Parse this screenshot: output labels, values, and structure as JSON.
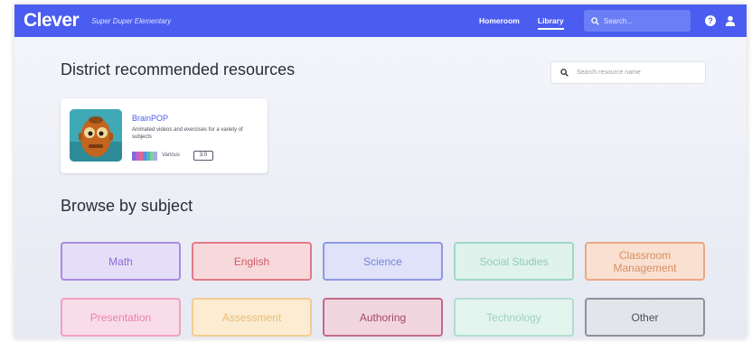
{
  "header": {
    "logo": "Clever",
    "school_name": "Super Duper Elementary",
    "nav": [
      "Homeroom",
      "Library"
    ],
    "active_nav": "Library",
    "search_placeholder": "Search..."
  },
  "district": {
    "heading": "District recommended resources",
    "search_placeholder": "Search resource name"
  },
  "resource_card": {
    "name": "BrainPOP",
    "description": "Animated videos and exercises for a variety of subjects",
    "verified_label": "Various",
    "version": "3.0"
  },
  "browse": {
    "heading": "Browse by subject",
    "subjects": [
      {
        "label": "Math",
        "bg": "#e5def8",
        "border": "#a98be0",
        "color": "#8a6bd6"
      },
      {
        "label": "English",
        "bg": "#f7d9dc",
        "border": "#e37a86",
        "color": "#d05a68"
      },
      {
        "label": "Science",
        "bg": "#dfe2f8",
        "border": "#8d98e4",
        "color": "#7784d8"
      },
      {
        "label": "Social Studies",
        "bg": "#dff2ec",
        "border": "#9fd8c6",
        "color": "#8fcdb9"
      },
      {
        "label": "Classroom Management",
        "bg": "#f9e0d1",
        "border": "#eba983",
        "color": "#d98e61"
      },
      {
        "label": "Presentation",
        "bg": "#f8dde8",
        "border": "#f0a1c1",
        "color": "#e883ab"
      },
      {
        "label": "Assessment",
        "bg": "#fbecd2",
        "border": "#f2cd91",
        "color": "#ebbd71"
      },
      {
        "label": "Authoring",
        "bg": "#f1d6df",
        "border": "#c36a89",
        "color": "#a5466b"
      },
      {
        "label": "Technology",
        "bg": "#e3f3ee",
        "border": "#b0ddcf",
        "color": "#9fd2c1"
      },
      {
        "label": "Other",
        "bg": "#e4e5ea",
        "border": "#8e909a",
        "color": "#4c4e58"
      }
    ]
  },
  "colors": {
    "brand": "#4a5df0"
  }
}
